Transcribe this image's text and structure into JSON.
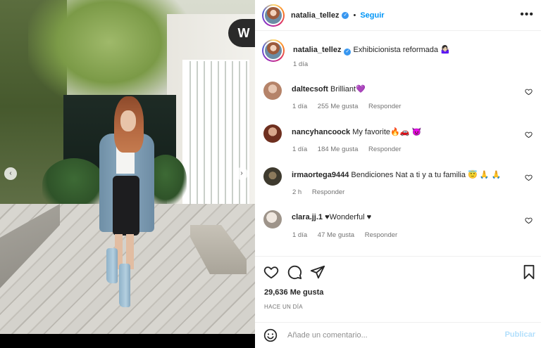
{
  "post": {
    "author": "natalia_tellez",
    "verified": true,
    "follow_label": "Seguir",
    "more_label": "•••",
    "separator": "•",
    "watermark": "W"
  },
  "caption": {
    "user": "natalia_tellez",
    "text": "Exhibicionista reformada 🤷🏻‍♀️",
    "time": "1 día"
  },
  "comments": [
    {
      "user": "daltecsoft",
      "text": "Brilliant💜",
      "time": "1 día",
      "likes": "255 Me gusta",
      "reply": "Responder",
      "avatar_color": "#c9a189"
    },
    {
      "user": "nancyhancoock",
      "text": "My favorite🔥🚗 👿",
      "time": "1 día",
      "likes": "184 Me gusta",
      "reply": "Responder",
      "avatar_color": "#7d3a28"
    },
    {
      "user": "irmaortega9444",
      "text": "Bendiciones Nat a ti y a tu familia 😇 🙏 🙏",
      "time": "2 h",
      "likes": "",
      "reply": "Responder",
      "avatar_color": "#55503f"
    },
    {
      "user": "clara.jj.1",
      "text": "♥Wonderful ♥",
      "time": "1 día",
      "likes": "47 Me gusta",
      "reply": "Responder",
      "avatar_color": "#b7b0a8"
    }
  ],
  "stats": {
    "likes": "29,636 Me gusta",
    "posted_ago": "HACE UN DÍA"
  },
  "composer": {
    "placeholder": "Añade un comentario...",
    "submit_label": "Publicar"
  },
  "icons": {
    "like": "heart-icon",
    "comment": "comment-icon",
    "share": "paper-plane-icon",
    "save": "bookmark-icon",
    "emoji": "smiley-icon"
  },
  "colors": {
    "link": "#0095f6",
    "verified": "#3897f0",
    "muted": "#737373",
    "publish_disabled": "#b2dffc"
  }
}
